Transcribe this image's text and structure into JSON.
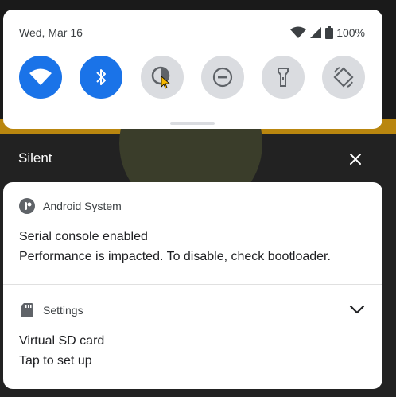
{
  "quick_settings": {
    "date": "Wed, Mar 16",
    "battery": "100%",
    "tiles": [
      {
        "name": "wifi",
        "icon": "wifi-icon",
        "state": "on"
      },
      {
        "name": "bluetooth",
        "icon": "bluetooth-icon",
        "state": "on"
      },
      {
        "name": "dark-theme",
        "icon": "dark-theme-icon",
        "state": "off"
      },
      {
        "name": "do-not-disturb",
        "icon": "do-not-disturb-icon",
        "state": "off"
      },
      {
        "name": "flashlight",
        "icon": "flashlight-icon",
        "state": "off"
      },
      {
        "name": "auto-rotate",
        "icon": "auto-rotate-icon",
        "state": "off"
      }
    ]
  },
  "section": {
    "label": "Silent"
  },
  "notifications": [
    {
      "app": "Android System",
      "title": "Serial console enabled",
      "text": "Performance is impacted. To disable, check bootloader."
    },
    {
      "app": "Settings",
      "title": "Virtual SD card",
      "text": "Tap to set up"
    }
  ],
  "colors": {
    "accent": "#1a73e8",
    "tile_off": "#dadce0",
    "panel": "#ffffff",
    "shade": "#222222"
  }
}
